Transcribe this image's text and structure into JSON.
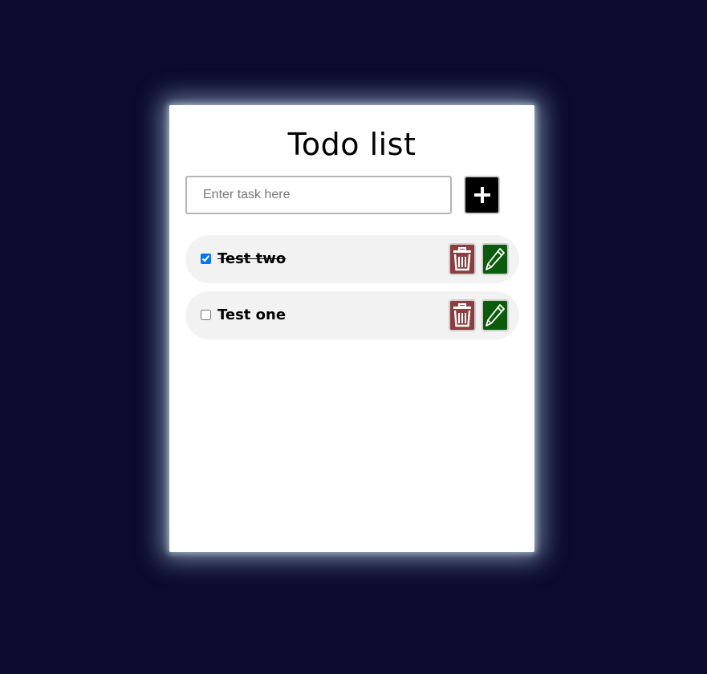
{
  "app": {
    "title": "Todo list"
  },
  "input": {
    "placeholder": "Enter task here",
    "value": ""
  },
  "add_button": {
    "icon": "plus-icon"
  },
  "todos": [
    {
      "text": "Test two",
      "completed": true
    },
    {
      "text": "Test one",
      "completed": false
    }
  ],
  "icons": {
    "delete": "trash-icon",
    "edit": "pencil-icon"
  },
  "colors": {
    "background": "#0c0c2e",
    "card": "#ffffff",
    "item": "#f2f2f2",
    "delete": "#8a3f3f",
    "edit": "#0a5c0a",
    "add": "#000000"
  }
}
